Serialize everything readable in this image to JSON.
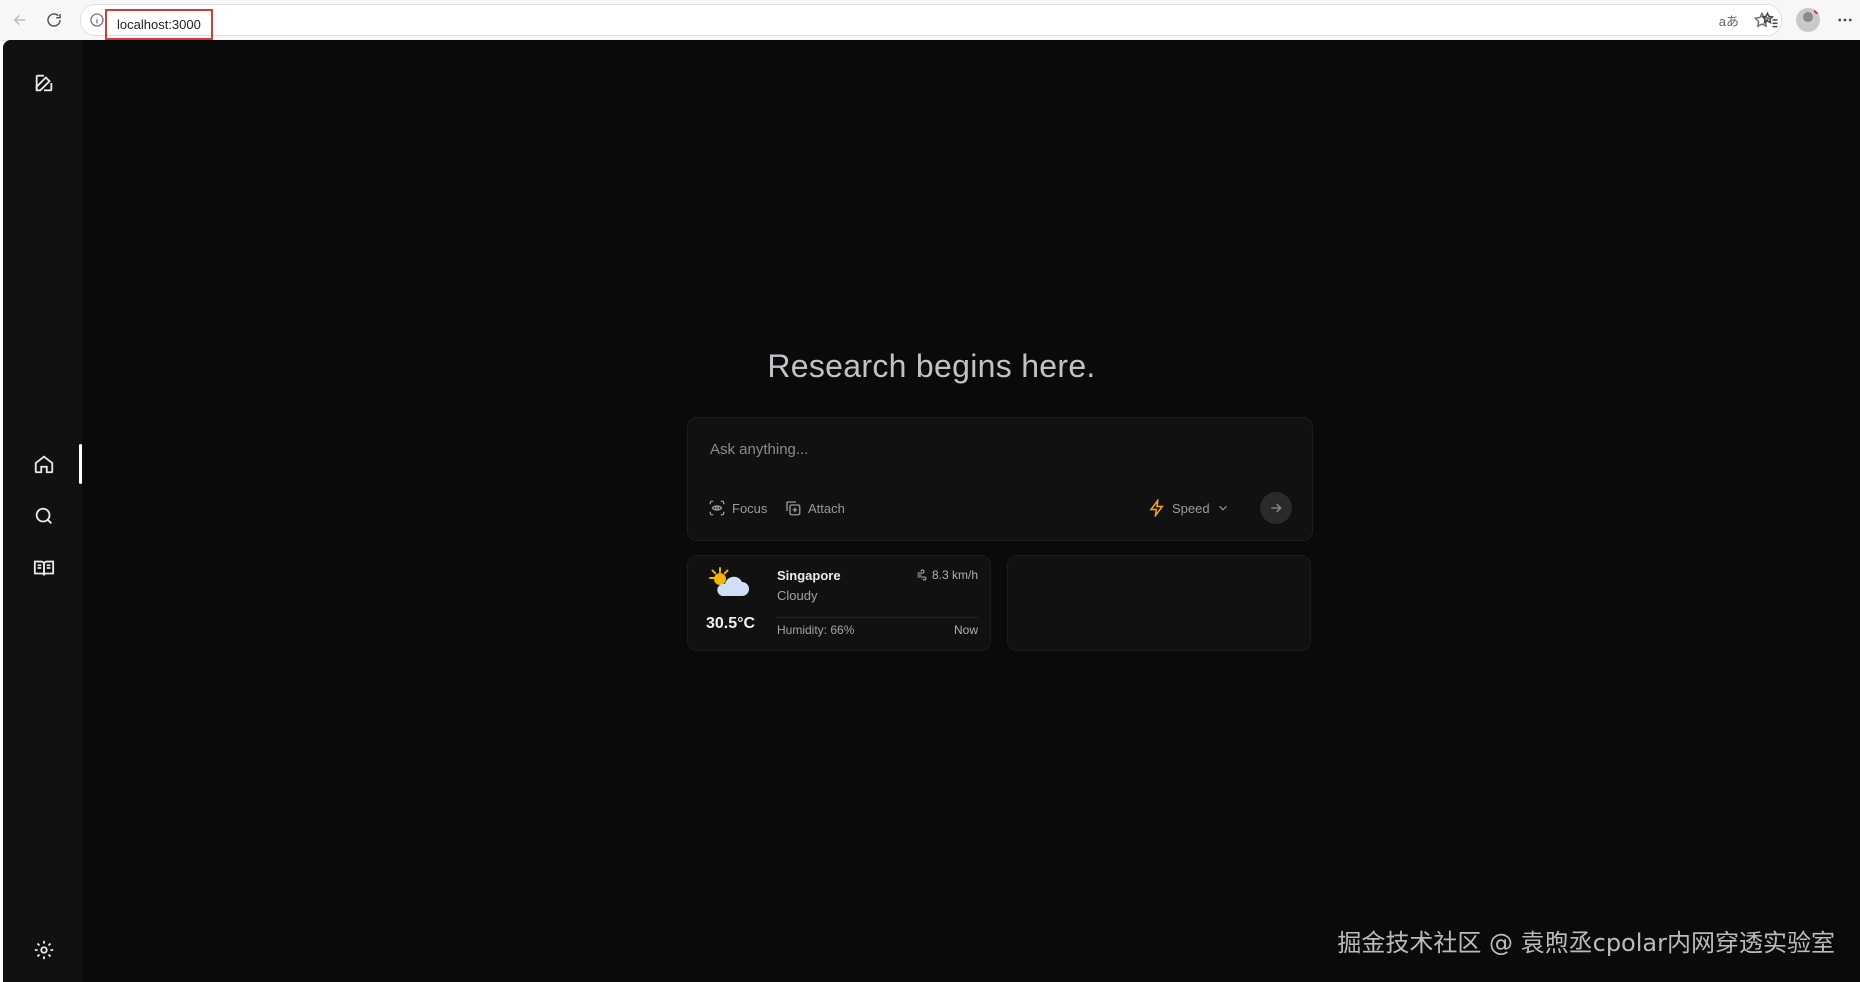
{
  "browser": {
    "url": "localhost:3000",
    "read_aloud_label": "aあ"
  },
  "sidebar": {
    "items": [
      {
        "name": "new-chat",
        "icon": "edit-icon"
      },
      {
        "name": "home",
        "icon": "home-icon",
        "active": true
      },
      {
        "name": "discover",
        "icon": "search-icon"
      },
      {
        "name": "library",
        "icon": "book-open-icon"
      },
      {
        "name": "settings",
        "icon": "gear-icon"
      }
    ]
  },
  "main": {
    "headline": "Research begins here.",
    "ask": {
      "placeholder": "Ask anything...",
      "focus_label": "Focus",
      "attach_label": "Attach",
      "mode_label": "Speed"
    },
    "weather": {
      "city": "Singapore",
      "condition": "Cloudy",
      "temperature": "30.5°C",
      "wind": "8.3 km/h",
      "humidity": "Humidity: 66%",
      "time": "Now"
    }
  },
  "watermark": "掘金技术社区 @ 袁煦丞cpolar内网穿透实验室",
  "colors": {
    "background": "#0a0a0a",
    "sidebar": "#111111",
    "accent_speed": "#f5a623"
  }
}
